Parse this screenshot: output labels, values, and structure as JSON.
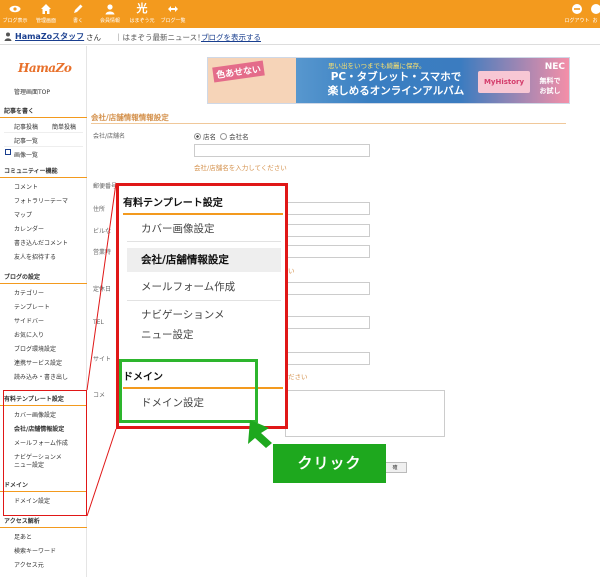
{
  "topbar": {
    "left_items": [
      {
        "label": "ブログ表示",
        "icon": "eye-icon"
      },
      {
        "label": "管理画面",
        "icon": "home-icon"
      },
      {
        "label": "書く",
        "icon": "pen-icon"
      },
      {
        "label": "会員情報",
        "icon": "user-icon"
      },
      {
        "label": "はまぞう元",
        "icon": "hikari-icon",
        "glyph": "光"
      },
      {
        "label": "ブログ一覧",
        "icon": "arrows-icon"
      }
    ],
    "right_items": [
      {
        "label": "ログアウト",
        "icon": "logout-icon"
      },
      {
        "label": "お",
        "icon": "help-icon"
      }
    ]
  },
  "status": {
    "username": "HamaZoスタッフ",
    "suffix": "さん",
    "news": "｜はまぞう最新ニュース！｜",
    "blog_link": "ブログを表示する"
  },
  "sidebar": {
    "logo": "HamaZo",
    "top_link": "管理画面TOP",
    "sections": [
      {
        "title": "記事を書く"
      },
      {
        "title": "コミュニティー機能"
      },
      {
        "title": "ブログの設定"
      },
      {
        "title": "有料テンプレート設定"
      },
      {
        "title": "ドメイン"
      },
      {
        "title": "アクセス解析"
      }
    ],
    "write": [
      "記事投稿",
      "簡単投稿",
      "記事一覧",
      "画像一覧"
    ],
    "community": [
      "コメント",
      "フォトラリーテーマ",
      "マップ",
      "カレンダー",
      "書き込んだコメント",
      "友人を招待する"
    ],
    "blog_settings": [
      "カテゴリー",
      "テンプレート",
      "サイドバー",
      "お気に入り",
      "ブログ環境設定",
      "連携サービス設定",
      "読み込み・書き出し"
    ],
    "paid_template": [
      "カバー画像設定",
      "会社/店舗情報設定",
      "メールフォーム作成",
      "ナビゲーションメ",
      "ニュー設定"
    ],
    "domain": [
      "ドメイン設定"
    ],
    "analytics": [
      "足あと",
      "検索キーワード",
      "アクセス元"
    ]
  },
  "banner": {
    "badge": "色あせない",
    "top_text": "思い出をいつまでも綺麗に保存。",
    "main_text_1": "PC・タブレット・スマホで",
    "main_text_2": "楽しめるオンラインアルバム",
    "product": "MyHistory",
    "brand": "NEC",
    "free_1": "無料で",
    "free_2": "お試し"
  },
  "form": {
    "title": "会社/店舗情報情報設定",
    "company_label": "会社/店舗名",
    "radio_store": "店名",
    "radio_company": "会社名",
    "company_hint": "会社/店舗名を入力してください",
    "postal_label": "郵便番号",
    "address_label": "住所",
    "building_label": "ビルな",
    "hours_label": "営業時",
    "holiday_label": "定休日",
    "tel_label": "TEL",
    "site_label": "サイト",
    "comment_label": "コメ",
    "hint_tail_1": "い",
    "hint_tail_2": "ださい",
    "submit": "確"
  },
  "callout": {
    "paid_title": "有料テンプレート設定",
    "items": [
      "カバー画像設定",
      "会社/店舗情報設定",
      "メールフォーム作成",
      "ナビゲーションメ",
      "ニュー設定"
    ],
    "domain_title": "ドメイン",
    "domain_item": "ドメイン設定",
    "click_label": "クリック"
  },
  "colors": {
    "accent_orange": "#f39a1e",
    "callout_red": "#e01717",
    "highlight_green": "#2db52d",
    "click_green": "#1ea81e"
  }
}
